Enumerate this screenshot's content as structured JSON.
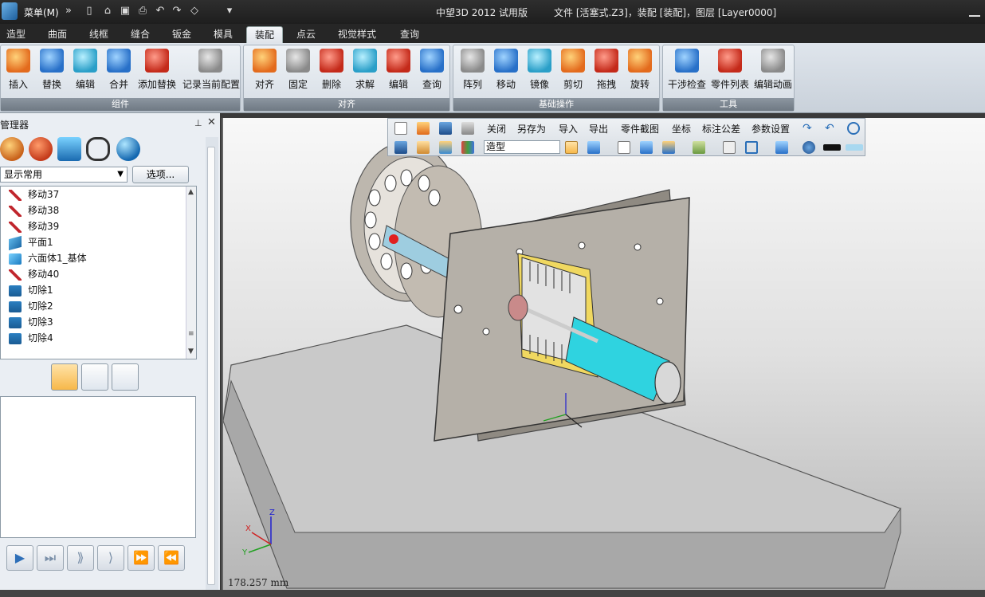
{
  "titlebar": {
    "menu_label": "菜单(M)",
    "app_title": "中望3D 2012 试用版",
    "file_info": "文件 [活塞式.Z3]，装配 [装配]，图层 [Layer0000]"
  },
  "tabs": [
    "造型",
    "曲面",
    "线框",
    "缝合",
    "钣金",
    "模具",
    "装配",
    "点云",
    "视觉样式",
    "查询"
  ],
  "active_tab": "装配",
  "ribbon": {
    "groups": [
      {
        "label": "组件",
        "buttons": [
          "插入",
          "替换",
          "编辑",
          "合并",
          "添加替换",
          "记录当前配置"
        ]
      },
      {
        "label": "对齐",
        "buttons": [
          "对齐",
          "固定",
          "删除",
          "求解",
          "编辑",
          "查询"
        ]
      },
      {
        "label": "基础操作",
        "buttons": [
          "阵列",
          "移动",
          "镜像",
          "剪切",
          "拖拽",
          "旋转"
        ]
      },
      {
        "label": "工具",
        "buttons": [
          "干涉检查",
          "零件列表",
          "编辑动画"
        ]
      }
    ]
  },
  "panel": {
    "title": "管理器",
    "filter_value": "显示常用",
    "options_label": "选项...",
    "tree_items": [
      {
        "label": "移动37",
        "icon": "move-icon"
      },
      {
        "label": "移动38",
        "icon": "move-icon"
      },
      {
        "label": "移动39",
        "icon": "move-icon"
      },
      {
        "label": "平面1",
        "icon": "plane-icon"
      },
      {
        "label": "六面体1_基体",
        "icon": "box-icon"
      },
      {
        "label": "移动40",
        "icon": "move-icon"
      },
      {
        "label": "切除1",
        "icon": "cut-icon"
      },
      {
        "label": "切除2",
        "icon": "cut-icon"
      },
      {
        "label": "切除3",
        "icon": "cut-icon"
      },
      {
        "label": "切除4",
        "icon": "cut-icon"
      }
    ]
  },
  "viewport_toolbar": {
    "row1": [
      "关闭",
      "另存为",
      "导入",
      "导出",
      "零件截图",
      "坐标",
      "标注公差",
      "参数设置"
    ],
    "mode_value": "造型"
  },
  "viewport": {
    "coord_readout": "178.257 mm"
  },
  "colors": {
    "ribbon_bg": "#dfe5ec",
    "accent_orange": "#f7b84a",
    "cylinder_cyan": "#2fd3e0",
    "yellow_part": "#f4d03f"
  }
}
